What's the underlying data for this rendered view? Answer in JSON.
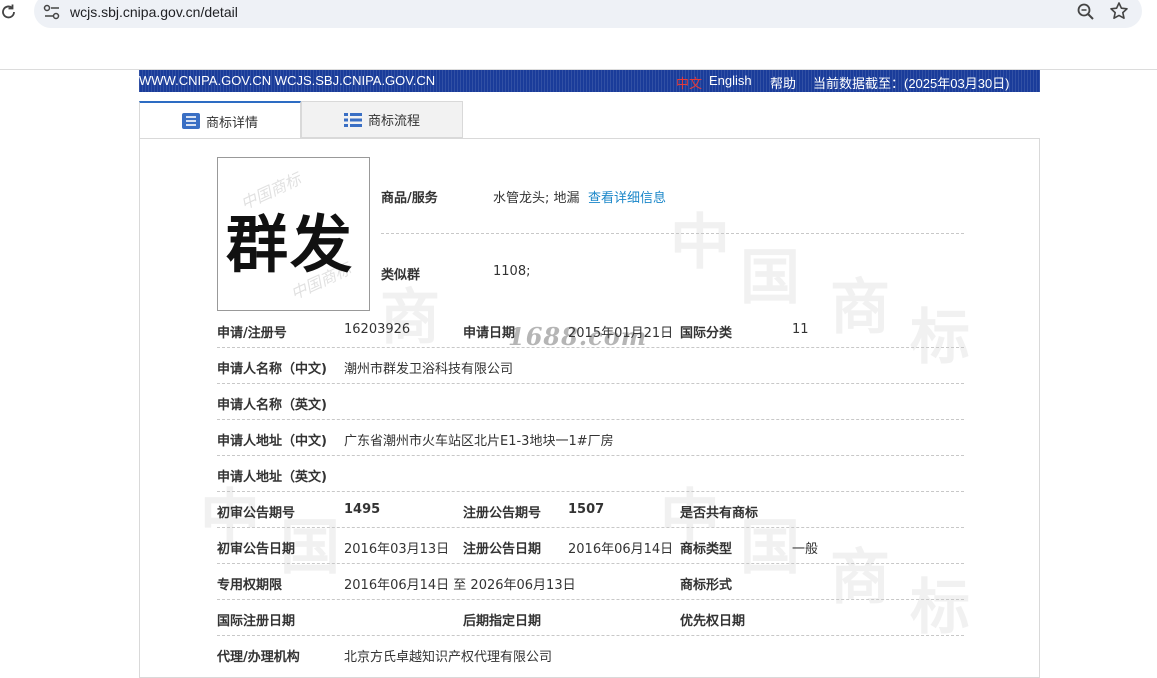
{
  "browser": {
    "url": "wcjs.sbj.cnipa.gov.cn/detail"
  },
  "topbar": {
    "site_links": "WWW.CNIPA.GOV.CN  WCJS.SBJ.CNIPA.GOV.CN",
    "lang_cn": "中文",
    "lang_en": "English",
    "help": "帮助",
    "data_date": "当前数据截至：(2025年03月30日)",
    "color": "#1a3c9a"
  },
  "tabs": [
    {
      "label": "商标详情",
      "icon": "list-detail-icon",
      "active": true
    },
    {
      "label": "商标流程",
      "icon": "list-flow-icon",
      "active": false
    }
  ],
  "trademark": {
    "image_text": "群发",
    "goods_label": "商品/服务",
    "goods_value": "水管龙头; 地漏",
    "goods_link": "查看详细信息",
    "similar_label": "类似群",
    "similar_value": "1108;",
    "reg_no_label": "申请/注册号",
    "reg_no": "16203926",
    "app_date_label": "申请日期",
    "app_date": "2015年01月21日",
    "intl_class_label": "国际分类",
    "intl_class": "11",
    "applicant_cn_label": "申请人名称（中文)",
    "applicant_cn": "潮州市群发卫浴科技有限公司",
    "applicant_en_label": "申请人名称（英文)",
    "address_cn_label": "申请人地址（中文)",
    "address_cn": "广东省潮州市火车站区北片E1-3地块一1#厂房",
    "address_en_label": "申请人地址（英文)",
    "prelim_no_label": "初审公告期号",
    "prelim_no": "1495",
    "reg_notice_no_label": "注册公告期号",
    "reg_notice_no": "1507",
    "shared_label": "是否共有商标",
    "prelim_date_label": "初审公告日期",
    "prelim_date": "2016年03月13日",
    "reg_notice_date_label": "注册公告日期",
    "reg_notice_date": "2016年06月14日",
    "tm_type_label": "商标类型",
    "tm_type": "一般",
    "exclusive_label": "专用权期限",
    "exclusive": "2016年06月14日 至 2026年06月13日",
    "tm_form_label": "商标形式",
    "intl_reg_date_label": "国际注册日期",
    "later_desig_label": "后期指定日期",
    "priority_label": "优先权日期",
    "agent_label": "代理/办理机构",
    "agent": "北京方氏卓越知识产权代理有限公司"
  },
  "overlay": {
    "mark": "1688.com"
  }
}
